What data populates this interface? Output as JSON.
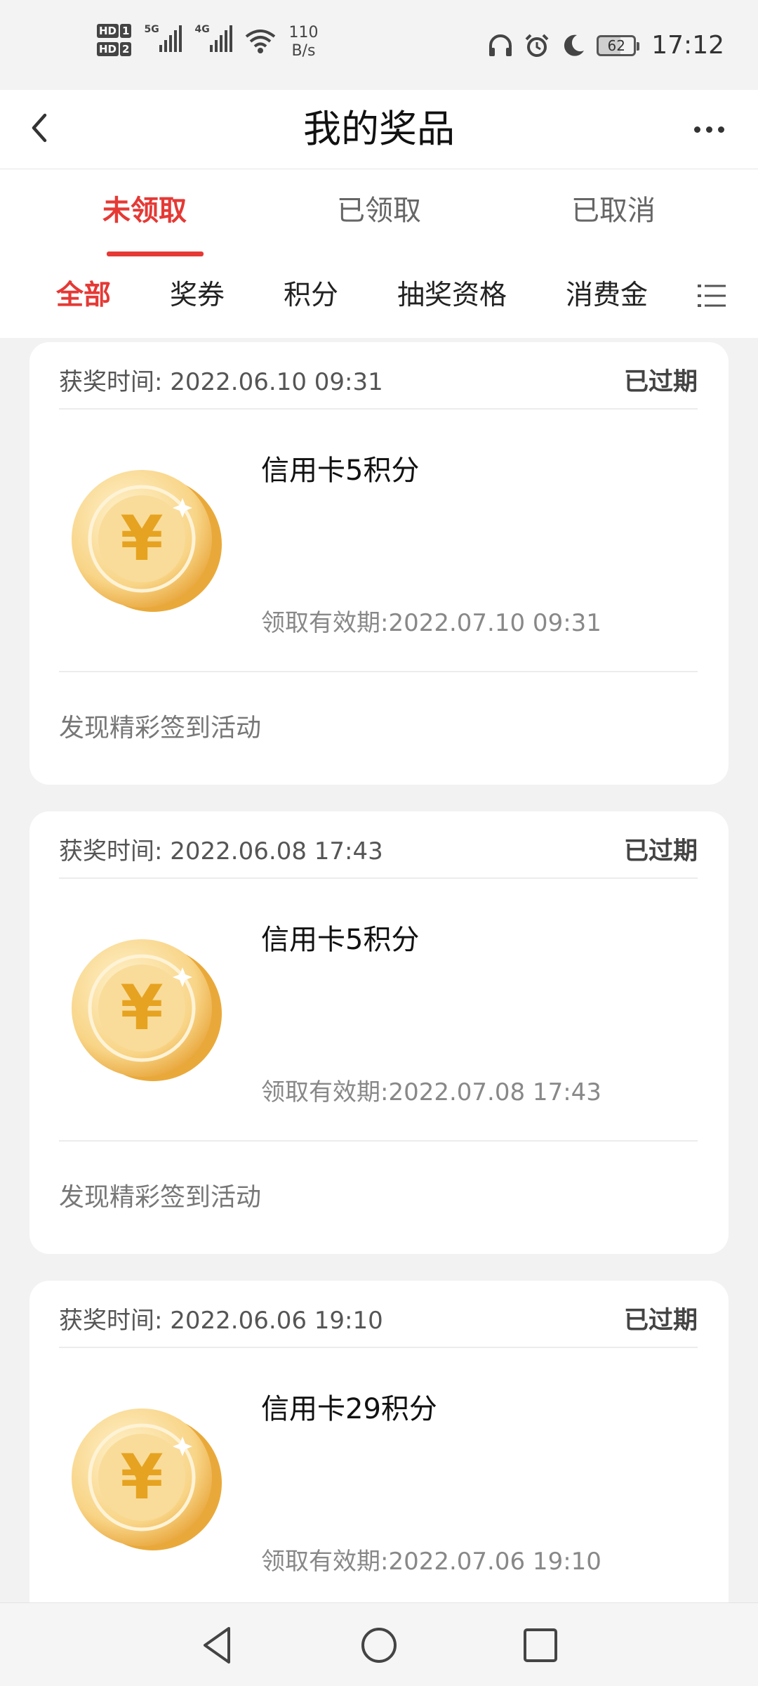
{
  "status_bar": {
    "sim1": "HD",
    "sim1_num": "1",
    "sim2": "HD",
    "sim2_num": "2",
    "net1": "5G",
    "net2": "4G",
    "speed_value": "110",
    "speed_unit": "B/s",
    "battery": "62",
    "time": "17:12",
    "icons": [
      "headphones-icon",
      "alarm-icon",
      "moon-icon"
    ]
  },
  "header": {
    "title": "我的奖品"
  },
  "tabs": [
    {
      "label": "未领取",
      "active": true
    },
    {
      "label": "已领取",
      "active": false
    },
    {
      "label": "已取消",
      "active": false
    }
  ],
  "categories": [
    {
      "label": "全部",
      "active": true
    },
    {
      "label": "奖券",
      "active": false
    },
    {
      "label": "积分",
      "active": false
    },
    {
      "label": "抽奖资格",
      "active": false
    },
    {
      "label": "消费金",
      "active": false
    }
  ],
  "prizes": [
    {
      "time_label": "获奖时间:",
      "time": "2022.06.10 09:31",
      "status": "已过期",
      "name": "信用卡5积分",
      "validity": "领取有效期:2022.07.10 09:31",
      "source": "发现精彩签到活动"
    },
    {
      "time_label": "获奖时间:",
      "time": "2022.06.08 17:43",
      "status": "已过期",
      "name": "信用卡5积分",
      "validity": "领取有效期:2022.07.08 17:43",
      "source": "发现精彩签到活动"
    },
    {
      "time_label": "获奖时间:",
      "time": "2022.06.06 19:10",
      "status": "已过期",
      "name": "信用卡29积分",
      "validity": "领取有效期:2022.07.06 19:10",
      "source": ""
    }
  ],
  "colors": {
    "accent": "#e53935",
    "coin_light": "#fbe3a6",
    "coin_dark": "#e9a93a"
  }
}
